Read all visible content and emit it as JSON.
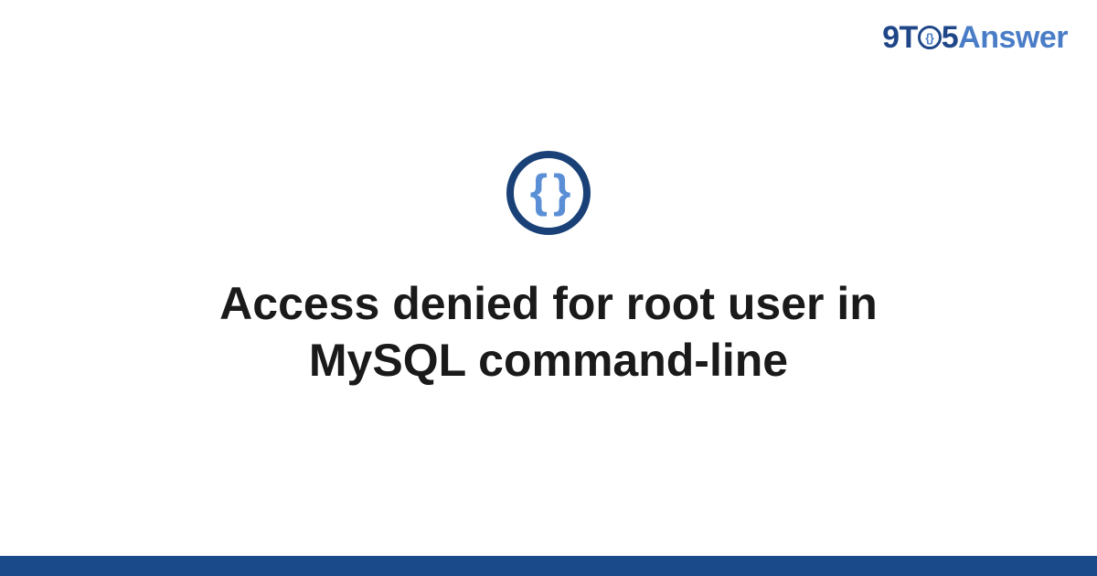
{
  "logo": {
    "prefix": "9T",
    "middle": "5",
    "suffix": "Answer",
    "brace_glyph": "{}"
  },
  "icon": {
    "glyph": "{ }"
  },
  "title": "Access denied for root user in MySQL command-line",
  "colors": {
    "brand_dark": "#1f4788",
    "brand_light": "#4a7dc7",
    "footer": "#1a4a8a"
  }
}
